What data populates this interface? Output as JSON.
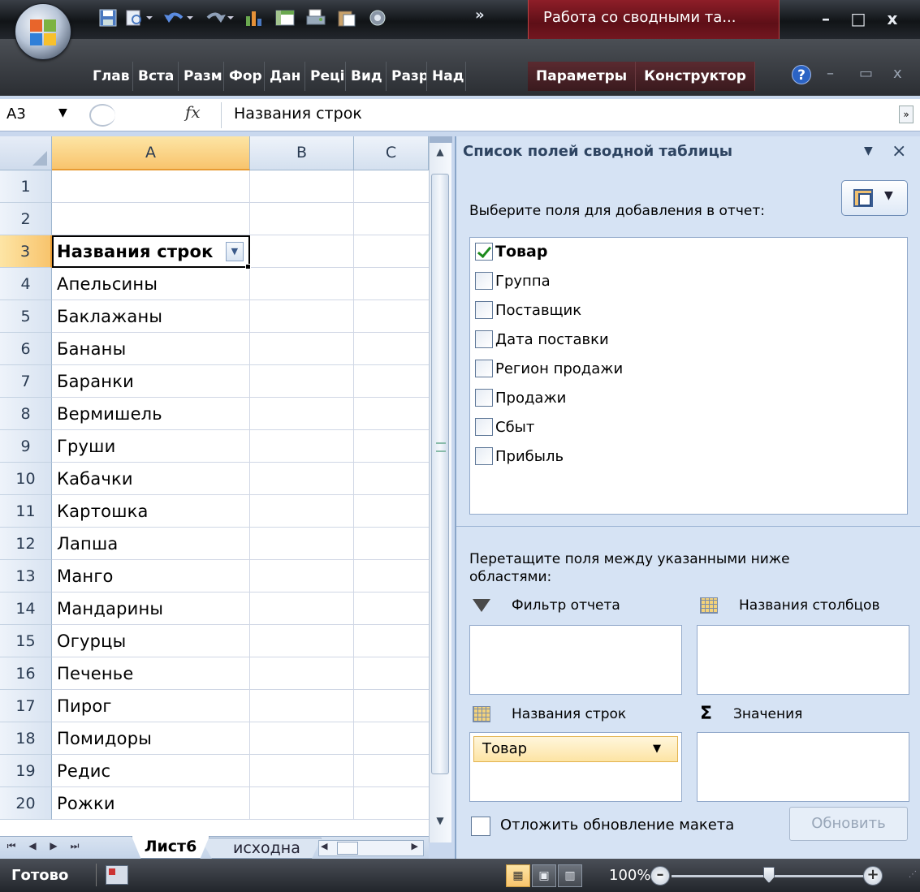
{
  "title_bar": {
    "context_title": "Работа со сводными та...",
    "qat_icons": [
      "save-icon",
      "print-preview-icon",
      "undo-icon",
      "redo-icon",
      "chart-icon",
      "pivot-icon",
      "print-icon",
      "paste-icon",
      "record-icon"
    ],
    "overflow": "»",
    "window_controls": [
      "–",
      "□",
      "x"
    ]
  },
  "ribbon": {
    "tabs": [
      "Глав",
      "Вста",
      "Разм",
      "Фор",
      "Дан",
      "Реці",
      "Вид",
      "Разр",
      "Над"
    ],
    "context_tabs": [
      "Параметры",
      "Конструктор"
    ],
    "help": "?",
    "workbook_controls": [
      "–",
      "▭",
      "x"
    ]
  },
  "formula_bar": {
    "name_box": "A3",
    "fx": "fx",
    "value": "Названия строк"
  },
  "grid": {
    "columns": [
      "A",
      "B",
      "C"
    ],
    "selected_column": "A",
    "rows": [
      {
        "n": "1",
        "a": ""
      },
      {
        "n": "2",
        "a": ""
      },
      {
        "n": "3",
        "a": "Названия строк"
      },
      {
        "n": "4",
        "a": "Апельсины"
      },
      {
        "n": "5",
        "a": "Баклажаны"
      },
      {
        "n": "6",
        "a": "Бананы"
      },
      {
        "n": "7",
        "a": "Баранки"
      },
      {
        "n": "8",
        "a": "Вермишель"
      },
      {
        "n": "9",
        "a": "Груши"
      },
      {
        "n": "10",
        "a": "Кабачки"
      },
      {
        "n": "11",
        "a": "Картошка"
      },
      {
        "n": "12",
        "a": "Лапша"
      },
      {
        "n": "13",
        "a": "Манго"
      },
      {
        "n": "14",
        "a": "Мандарины"
      },
      {
        "n": "15",
        "a": "Огурцы"
      },
      {
        "n": "16",
        "a": "Печенье"
      },
      {
        "n": "17",
        "a": "Пирог"
      },
      {
        "n": "18",
        "a": "Помидоры"
      },
      {
        "n": "19",
        "a": "Редис"
      },
      {
        "n": "20",
        "a": "Рожки"
      }
    ],
    "active_row": "3"
  },
  "sheet_tabs": {
    "active": "Лист6",
    "other": "исходна"
  },
  "status_bar": {
    "ready": "Готово",
    "zoom": "100%",
    "zoom_level_percent": 100
  },
  "pivot_pane": {
    "title": "Список полей сводной таблицы",
    "choose_label": "Выберите поля для добавления в отчет:",
    "fields": [
      {
        "label": "Товар",
        "checked": true
      },
      {
        "label": "Группа",
        "checked": false
      },
      {
        "label": "Поставщик",
        "checked": false
      },
      {
        "label": "Дата поставки",
        "checked": false
      },
      {
        "label": "Регион продажи",
        "checked": false
      },
      {
        "label": "Продажи",
        "checked": false
      },
      {
        "label": "Сбыт",
        "checked": false
      },
      {
        "label": "Прибыль",
        "checked": false
      }
    ],
    "drag_instruction": "Перетащите поля между указанными ниже областями:",
    "areas": {
      "filter": "Фильтр отчета",
      "columns": "Названия столбцов",
      "rows": "Названия строк",
      "values": "Значения"
    },
    "row_field": "Товар",
    "defer_label": "Отложить обновление макета",
    "update_button": "Обновить"
  }
}
